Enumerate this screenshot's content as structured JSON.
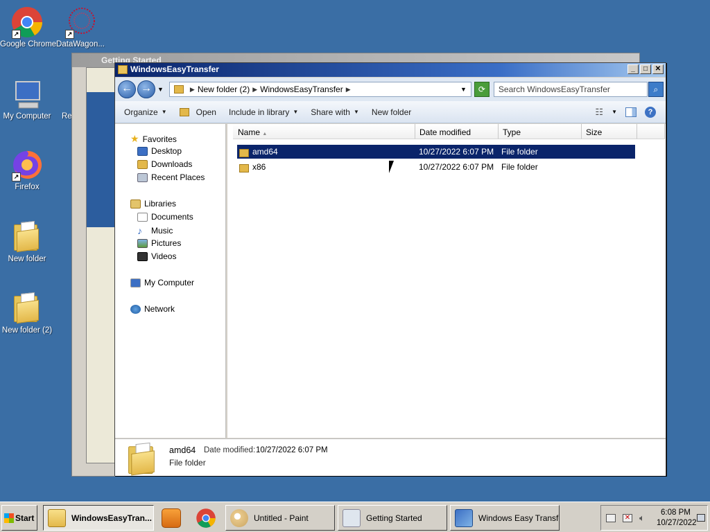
{
  "desktop": {
    "icons": [
      {
        "label": "Google Chrome"
      },
      {
        "label": "DataWagon..."
      },
      {
        "label": "My Computer"
      },
      {
        "label": "Re"
      },
      {
        "label": "Firefox"
      },
      {
        "label": "New folder"
      },
      {
        "label": "New folder (2)"
      }
    ]
  },
  "background_window": {
    "title": "Getting Started"
  },
  "explorer": {
    "title": "WindowsEasyTransfer",
    "address": {
      "crumbs": [
        "New folder (2)",
        "WindowsEasyTransfer"
      ]
    },
    "search": {
      "placeholder": "Search WindowsEasyTransfer"
    },
    "toolbar": {
      "organize": "Organize",
      "open": "Open",
      "include_in_library": "Include in library",
      "share_with": "Share with",
      "new_folder": "New folder",
      "help": "?"
    },
    "nav": {
      "favorites": "Favorites",
      "desktop": "Desktop",
      "downloads": "Downloads",
      "recent_places": "Recent Places",
      "libraries": "Libraries",
      "documents": "Documents",
      "music": "Music",
      "pictures": "Pictures",
      "videos": "Videos",
      "my_computer": "My Computer",
      "network": "Network"
    },
    "columns": {
      "name": "Name",
      "date_modified": "Date modified",
      "type": "Type",
      "size": "Size"
    },
    "files": [
      {
        "name": "amd64",
        "date": "10/27/2022 6:07 PM",
        "type": "File folder",
        "selected": true
      },
      {
        "name": "x86",
        "date": "10/27/2022 6:07 PM",
        "type": "File folder",
        "selected": false
      }
    ],
    "details": {
      "name": "amd64",
      "date_label": "Date modified:",
      "date_value": "10/27/2022 6:07 PM",
      "type": "File folder"
    }
  },
  "taskbar": {
    "start": "Start",
    "buttons": [
      {
        "label": "WindowsEasyTran...",
        "active": true
      },
      {
        "label": "Untitled - Paint"
      },
      {
        "label": "Getting Started"
      },
      {
        "label": "Windows Easy Transfer"
      }
    ],
    "clock": {
      "time": "6:08 PM",
      "date": "10/27/2022"
    }
  },
  "colors": {
    "selection": "#0a246a",
    "desktop": "#3a6ea5",
    "titlebar": "#0a246a"
  }
}
